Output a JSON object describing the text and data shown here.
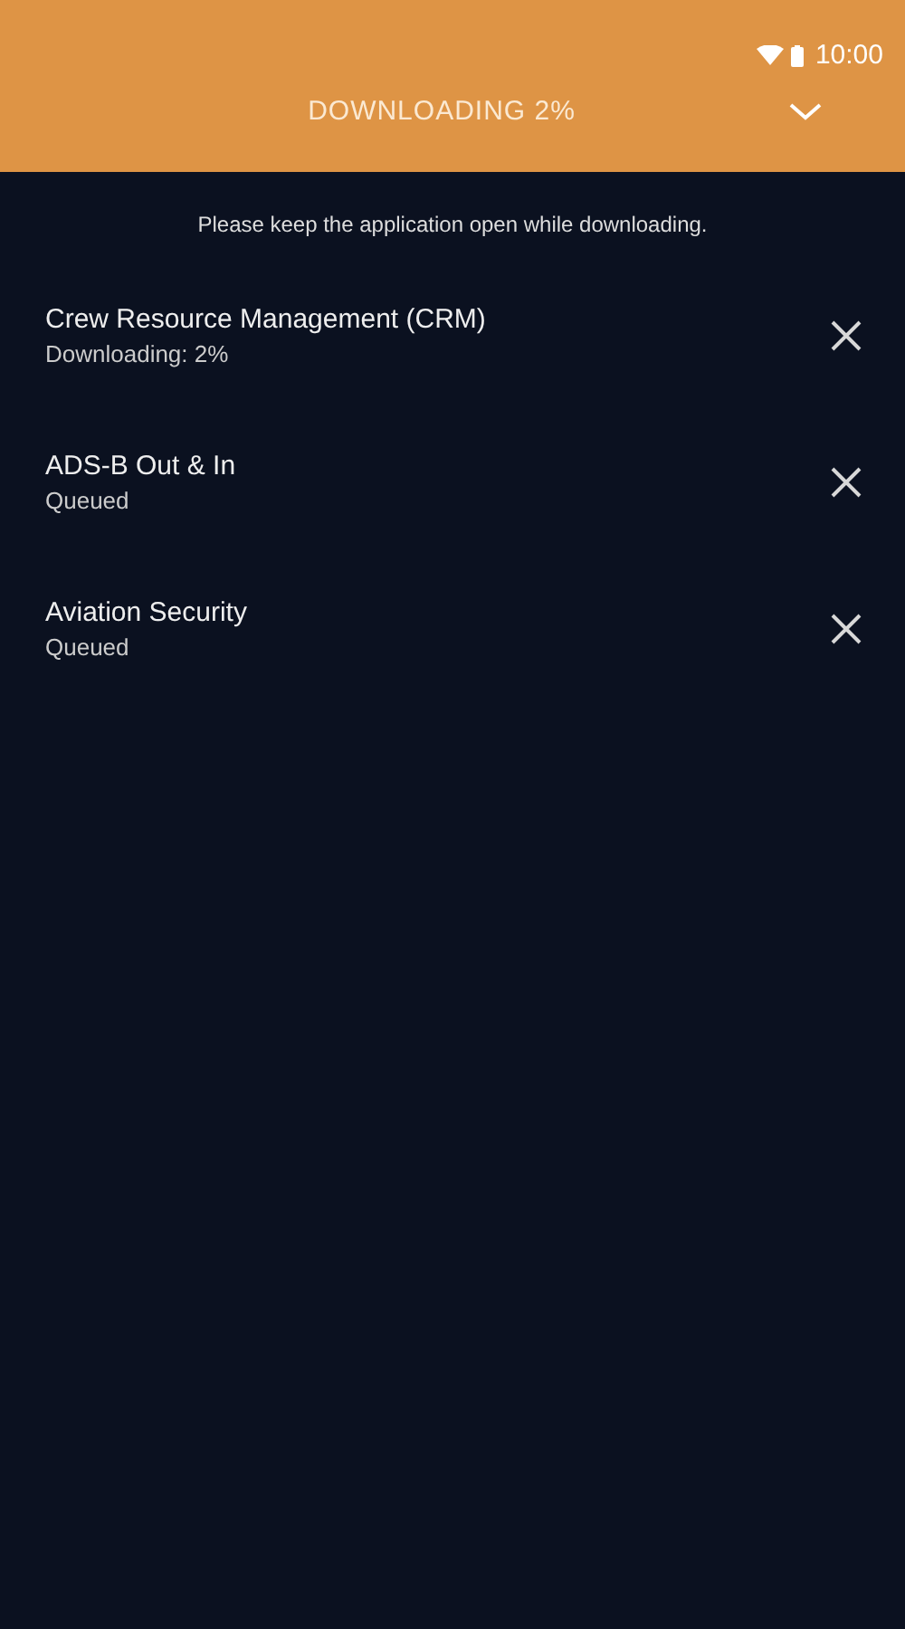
{
  "status_bar": {
    "time": "10:00"
  },
  "header": {
    "title": "DOWNLOADING 2%"
  },
  "notice": "Please keep the application open while downloading.",
  "downloads": [
    {
      "title": "Crew Resource Management (CRM)",
      "status": "Downloading: 2%"
    },
    {
      "title": "ADS-B Out & In",
      "status": "Queued"
    },
    {
      "title": "Aviation Security",
      "status": "Queued"
    }
  ]
}
